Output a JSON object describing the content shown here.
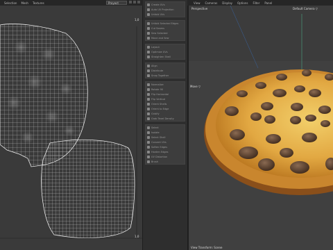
{
  "menubar": {
    "items": [
      "Selection",
      "Mesh",
      "Textures"
    ]
  },
  "uv_editor": {
    "dropdown_value": "Proyect",
    "corner_top_right": "1,0",
    "corner_bottom_right": "1,0"
  },
  "viewport_menu": {
    "items": [
      "View",
      "Cameras",
      "Display",
      "Options",
      "Filter",
      "Panel"
    ]
  },
  "viewport": {
    "perspective_label": "Perspective",
    "camera_label": "Default Camera ▽",
    "move_label": "Move ▽",
    "status_text": "View Transform: Scene"
  },
  "tool_groups": [
    [
      "Create UVs",
      "Auto UV Projection",
      "Unfold UVs"
    ],
    [
      "Unfold Selected Edges",
      "Cut Seams",
      "Sew Selected",
      "Move and Sew"
    ],
    [
      "Layout",
      "Optimize UVs",
      "Straighten Shell"
    ],
    [
      "Align",
      "Distribute",
      "Snap Together"
    ],
    [
      "Normalize",
      "Rotate 90",
      "Flip Horizontal",
      "Flip Vertical",
      "Orient Shells",
      "Orient to Edge",
      "Gridify",
      "Grab Texel Density"
    ],
    [
      "Select",
      "Isolate",
      "Select Shell",
      "Convert UVs",
      "Soften Edges",
      "Harden Edges",
      "UV Distortion",
      "Brush"
    ]
  ],
  "colors": {
    "uv_background": "#3a3a3a",
    "viewport_background": "#404040",
    "panel": "#2e2e2e",
    "pizza_crust": "#c9862e",
    "cheese": "#e6b44a",
    "sausage": "#5a3d28"
  }
}
